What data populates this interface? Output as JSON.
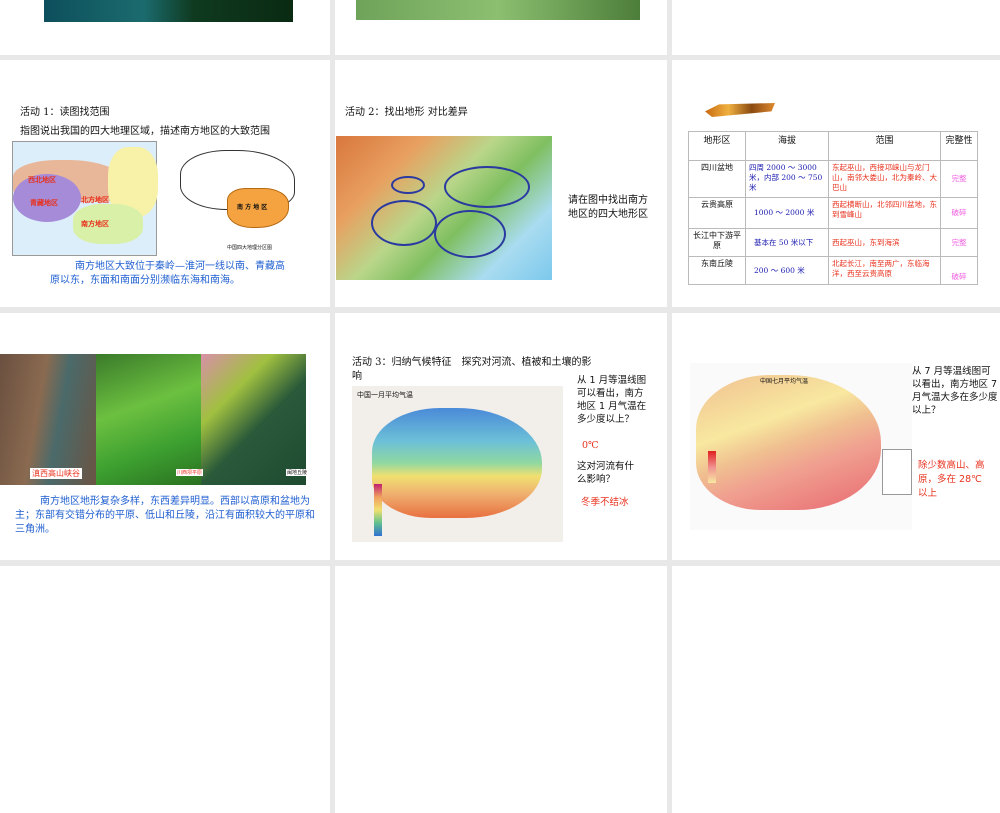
{
  "slides": [
    {
      "id": "top-1"
    },
    {
      "id": "top-2"
    },
    {
      "id": "top-3"
    },
    {
      "title": "活动 1：读图找范围",
      "subtitle": "指图说出我国的四大地理区域，描述南方地区的大致范围",
      "map_labels": [
        "西北地区",
        "青藏地区",
        "北方地区",
        "南方地区"
      ],
      "right_map_label": "南 方 地 区",
      "right_map_caption": "中国四大地理分区图",
      "answer": "南方地区大致位于秦岭—淮河一线以南、青藏高原以东，东面和南面分别濒临东海和南海。"
    },
    {
      "title": "活动 2：找出地形  对比差异",
      "question": "请在图中找出南方地区的四大地形区"
    },
    {
      "table": {
        "headers": [
          "地形区",
          "海拔",
          "范围",
          "完整性"
        ],
        "rows": [
          [
            "四川盆地",
            "四周 2000 ～ 3000 米，内部 200 ～ 750 米",
            "东起巫山，西接邛崃山与龙门山，南邻大娄山，北为秦岭、大巴山",
            "完整"
          ],
          [
            "云贵高原",
            "1000 ～ 2000 米",
            "西起横断山，北邻四川盆地，东到雪峰山",
            "破碎"
          ],
          [
            "长江中下游平原",
            "基本在 50 米以下",
            "西起巫山，东到海滨",
            "完整"
          ],
          [
            "东南丘陵",
            "200 ～ 600 米",
            "北起长江，南至两广，东临海洋，西至云贵高原",
            "破碎"
          ]
        ]
      }
    },
    {
      "photo_labels": [
        "滇西高山峡谷",
        "川西坝平原",
        "闽地丘陵"
      ],
      "description": "南方地区地形复杂多样，东西差异明显。西部以高原和盆地为主；东部有交错分布的平原、低山和丘陵，沿江有面积较大的平原和三角洲。"
    },
    {
      "title": "活动 3：归纳气候特征　探究对河流、植被和土壤的影响",
      "map_title": "中国一月平均气温",
      "q1": "从 1 月等温线图可以看出，南方地区 1 月气温在多少度以上？",
      "a1": "0℃",
      "q2": "这对河流有什么影响？",
      "a2": "冬季不结冰"
    },
    {
      "map_title": "中国七月平均气温",
      "question": "从 7 月等温线图可以看出，南方地区 7 月气温大多在多少度以上？",
      "answer": "除少数高山、高原，多在 28℃ 以上"
    },
    {
      "id": "bottom-1"
    },
    {
      "id": "bottom-2"
    },
    {
      "id": "bottom-3"
    }
  ]
}
